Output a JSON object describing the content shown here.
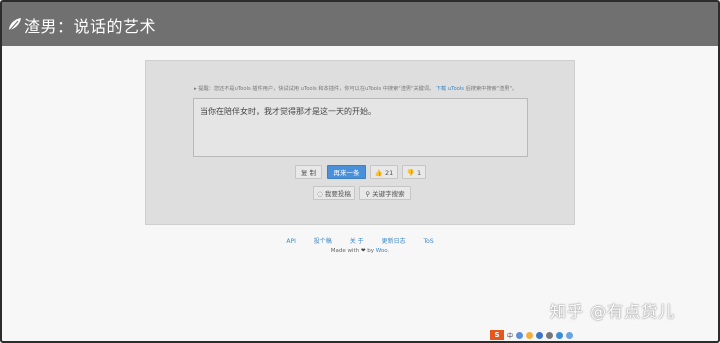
{
  "header": {
    "title": "渣男：说话的艺术"
  },
  "notice": {
    "text": "提醒：您还不是uTools 插件用户，快试试用 uTools 和本插件，你可以在uTools 中搜索\"渣男\"关键词。",
    "link": "下载 uTools",
    "suffix": "后搜索中搜索\"渣男\"。"
  },
  "main": {
    "quote": "当你在陪伴女时，我才觉得那才是这一天的开始。",
    "buttons": {
      "copy": "复 制",
      "next": "再来一条",
      "like": "21",
      "dislike": "1",
      "contribute": "我要投稿",
      "search": "关键字搜索"
    }
  },
  "footer": {
    "links": [
      "API",
      "投个稿",
      "关 于",
      "更新日志",
      "ToS"
    ],
    "made_prefix": "Made with",
    "made_by": "by",
    "made_author": "Woo."
  },
  "watermark": "知乎 @有点货儿",
  "tray": {
    "ime": "S",
    "lang": "中"
  }
}
